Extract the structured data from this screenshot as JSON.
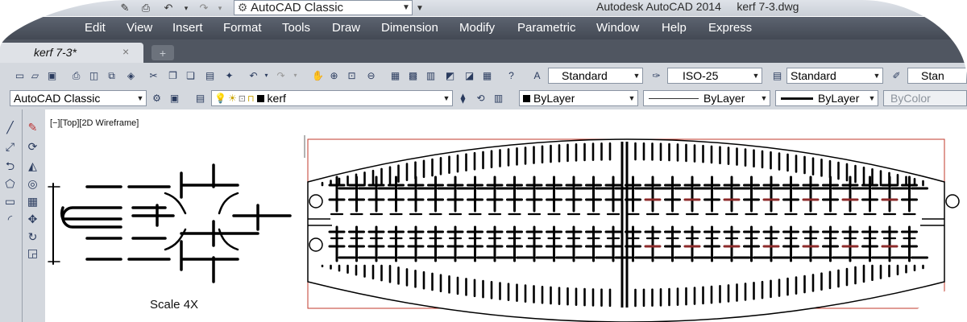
{
  "titlebar": {
    "workspace": "AutoCAD Classic",
    "title": "Autodesk AutoCAD 2014     kerf 7-3.dwg"
  },
  "menu": [
    "Edit",
    "View",
    "Insert",
    "Format",
    "Tools",
    "Draw",
    "Dimension",
    "Modify",
    "Parametric",
    "Window",
    "Help",
    "Express"
  ],
  "tabs": {
    "active": "kerf 7-3*",
    "close": "×",
    "new": "+"
  },
  "toolbar": {
    "text_style": "Standard",
    "dim_style": "ISO-25",
    "table_style": "Standard",
    "multileader_style": "Stan",
    "workspace": "AutoCAD Classic",
    "layer": "kerf",
    "color": "ByLayer",
    "linetype": "ByLayer",
    "lineweight": "ByLayer",
    "plotstyle": "ByColor"
  },
  "viewport": {
    "label": "[−][Top][2D Wireframe]"
  },
  "drawing": {
    "scale_label": "Scale 4X"
  },
  "colors": {
    "menubar": "#4d535e",
    "toolbar": "#d4d8de",
    "geometry": "#000000",
    "selection": "#c0392b"
  }
}
